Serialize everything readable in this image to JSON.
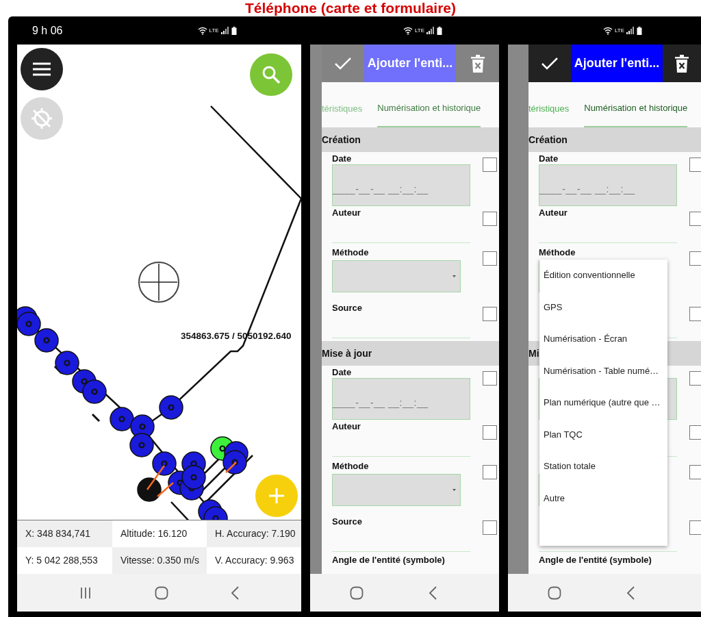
{
  "title": "Téléphone (carte et formulaire)",
  "screens": [
    {
      "kind": "map",
      "status": {
        "time": "9 h 06",
        "network": "LTE"
      },
      "coordinates": "354863.675 / 5050192.640",
      "info": [
        [
          "X: 348 834,741",
          "Altitude: 16.120",
          "H. Accuracy: 7.190"
        ],
        [
          "Y: 5 042 288,553",
          "Vitesse: 0.350 m/s",
          "V. Accuracy: 9.963"
        ]
      ],
      "nav": [
        {
          "kind": "recents"
        },
        {
          "kind": "home"
        },
        {
          "kind": "back"
        }
      ]
    },
    {
      "kind": "form",
      "faded": true,
      "status": {
        "network": "LTE"
      },
      "header": {
        "title": "Ajouter l'enti..."
      },
      "tabs": [
        {
          "label": "téristiques",
          "selected": false
        },
        {
          "label": "Numérisation et historique",
          "selected": true
        }
      ],
      "sections": [
        {
          "title": "Création",
          "fields": [
            {
              "label": "Date",
              "kind": "date",
              "value": "____-__-__ __:__:__",
              "checked": false
            },
            {
              "label": "Auteur",
              "kind": "text",
              "checked": false
            },
            {
              "label": "Méthode",
              "kind": "select",
              "checked": false
            },
            {
              "label": "Source",
              "kind": "text",
              "checked": false
            }
          ]
        },
        {
          "title": "Mise à jour",
          "fields": [
            {
              "label": "Date",
              "kind": "date",
              "value": "____-__-__ __:__:__",
              "checked": false
            },
            {
              "label": "Auteur",
              "kind": "text",
              "checked": false
            },
            {
              "label": "Méthode",
              "kind": "select",
              "checked": false
            },
            {
              "label": "Source",
              "kind": "text",
              "checked": false
            }
          ]
        }
      ],
      "footer_label": "Angle de l'entité (symbole)",
      "nav": [
        {
          "kind": "home"
        },
        {
          "kind": "back"
        }
      ]
    },
    {
      "kind": "form",
      "faded": false,
      "status": {
        "network": "LTE"
      },
      "header": {
        "title": "Ajouter l'enti..."
      },
      "tabs": [
        {
          "label": "téristiques",
          "selected": false
        },
        {
          "label": "Numérisation et historique",
          "selected": true
        }
      ],
      "sections": [
        {
          "title": "Création",
          "fields": [
            {
              "label": "Date",
              "kind": "date",
              "value": "____-__-__ __:__:__",
              "checked": false
            },
            {
              "label": "Auteur",
              "kind": "text",
              "checked": false
            },
            {
              "label": "Méthode",
              "kind": "select",
              "checked": false
            },
            {
              "kind": "text",
              "checked": false
            }
          ]
        },
        {
          "title": "Mi",
          "fields": [
            {
              "kind": "date",
              "checked": false
            },
            {
              "kind": "text",
              "checked": false
            },
            {
              "kind": "select",
              "checked": false
            },
            {
              "kind": "text",
              "checked": false
            }
          ]
        }
      ],
      "dropdown": {
        "options": [
          "Édition conventionnelle",
          "GPS",
          "Numérisation - Écran",
          "Numérisation - Table numé…",
          "Plan numérique (autre que …",
          "Plan TQC",
          "Station totale",
          "Autre"
        ]
      },
      "footer_label": "Angle de l'entité (symbole)",
      "nav": [
        {
          "kind": "home"
        },
        {
          "kind": "back"
        }
      ]
    }
  ]
}
